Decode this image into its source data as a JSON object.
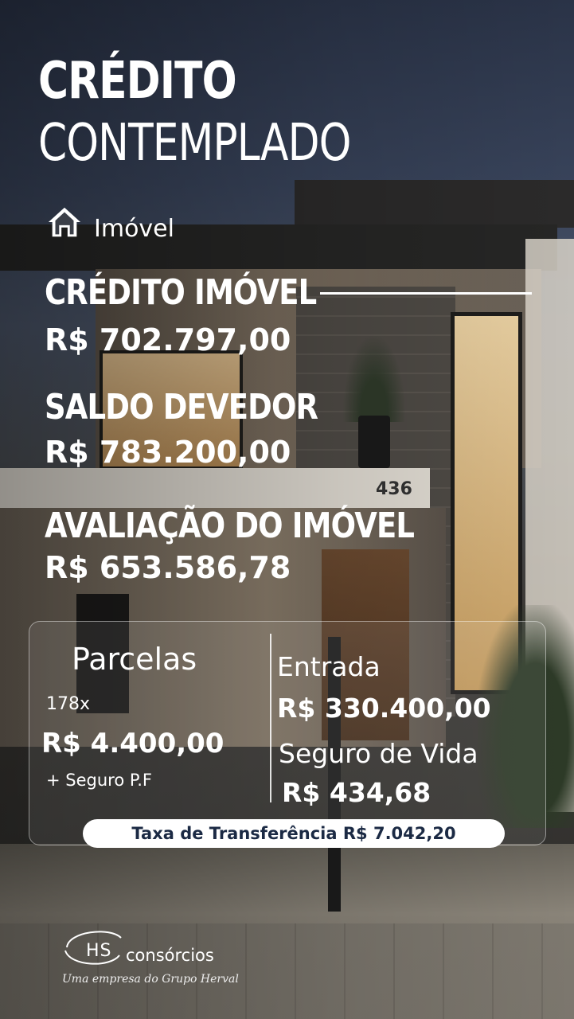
{
  "title": {
    "line1": "CRÉDITO",
    "line2": "CONTEMPLADO"
  },
  "category": {
    "icon": "home-icon",
    "label": "Imóvel"
  },
  "house_number": "436",
  "credito": {
    "label": "CRÉDITO IMÓVEL",
    "value": "R$ 702.797,00"
  },
  "saldo": {
    "label": "SALDO DEVEDOR",
    "value": "R$ 783.200,00"
  },
  "avaliacao": {
    "label": "AVALIAÇÃO DO IMÓVEL",
    "value": "R$ 653.586,78"
  },
  "parcelas": {
    "label": "Parcelas",
    "count": "178x",
    "value": "R$ 4.400,00",
    "note": "+ Seguro P.F"
  },
  "entrada": {
    "label": "Entrada",
    "value": "R$ 330.400,00"
  },
  "seguro": {
    "label": "Seguro de Vida",
    "value": "R$ 434,68"
  },
  "taxa": "Taxa de Transferência R$ 7.042,20",
  "logo": {
    "mark": "HS",
    "brand": "consórcios",
    "tagline": "Uma empresa do Grupo Herval"
  },
  "colors": {
    "pill_text": "#1b2a44",
    "text": "#ffffff"
  }
}
